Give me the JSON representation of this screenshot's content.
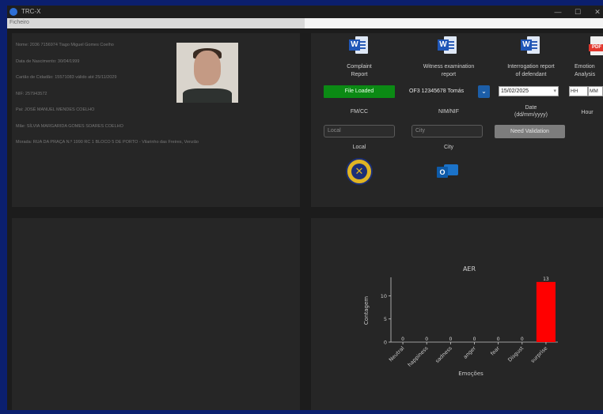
{
  "window": {
    "title": "TRC-X",
    "minimize": "—",
    "maximize": "☐",
    "close": "✕"
  },
  "menu": {
    "first": "Ficheiro"
  },
  "personal_info": {
    "lines": [
      "Nome: 2036 7156974 Tiago Miguel Gomes Coelho",
      "Data de Nascimento: 30/04/1999",
      "Cartão de Cidadão: 15571083 válido até 25/11/2029",
      "NIF: 257943572",
      "Pai: JOSÉ MANUEL MENDES COELHO",
      "Mãe: SÍLVIA MARGARIDA GOMES SOARES COELHO",
      "Morada: RUA DA PRAÇA N.º 1990 RC 1 BLOCO 5 DE PORTO - Vilarinho das Freires, Venzão"
    ]
  },
  "documents": [
    {
      "label": "Complaint\nReport",
      "icon": "word-icon"
    },
    {
      "label": "Witness examination\nreport",
      "icon": "word-icon"
    },
    {
      "label": "Interrogation report\nof defendant",
      "icon": "word-icon"
    },
    {
      "label": "Emotion\nAnalysis",
      "icon": "pdf-icon"
    }
  ],
  "controls": {
    "file_button": "File Loaded",
    "nim_value": "OF3 12345678 Tomás",
    "date_value": "15/02/2025",
    "hour_hh": "HH",
    "hour_mm": "MM",
    "fm_label": "FM/CC",
    "nim_label": "NIM/NIF",
    "date_label": "Date\n(dd/mm/yyyy)",
    "hour_label": "Hour",
    "local_placeholder": "Local",
    "city_placeholder": "City",
    "validation_button": "Need Validation",
    "local_label": "Local",
    "city_label": "City"
  },
  "colors": {
    "file_loaded": "#0b8a14",
    "bar": "#ff0000",
    "accent": "#1c5ea8"
  },
  "chart_data": {
    "type": "bar",
    "title": "AER",
    "xlabel": "Emoções",
    "ylabel": "Contagem",
    "categories": [
      "Neutral",
      "happiness",
      "sadness",
      "anger",
      "fear",
      "Disgust",
      "surprise"
    ],
    "values": [
      0,
      0,
      0,
      0,
      0,
      0,
      13
    ],
    "ylim": [
      0,
      14
    ],
    "yticks": [
      0,
      5,
      10
    ],
    "bar_color": "#ff0000",
    "data_labels": true
  }
}
